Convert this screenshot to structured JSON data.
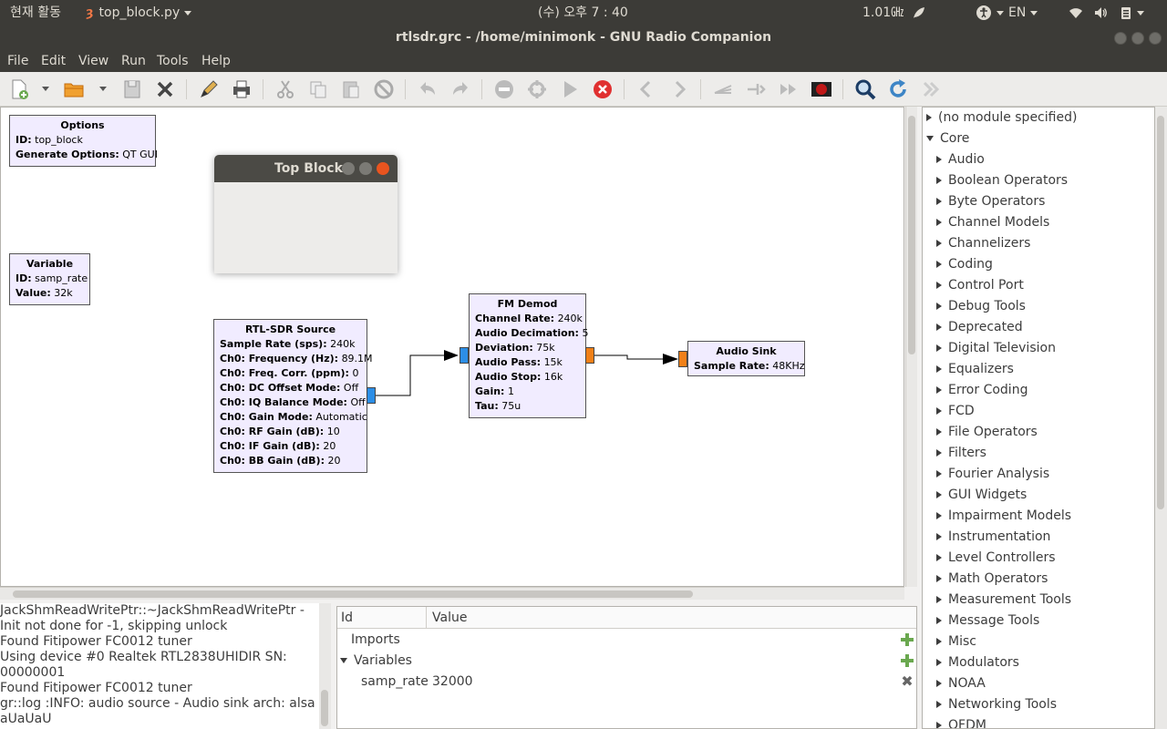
{
  "top_panel": {
    "activities": "현재 활동",
    "app_name": "top_block.py",
    "clock": "(수) 오후  7 : 40",
    "cpu_freq": "1.01㎓",
    "language": "EN"
  },
  "window": {
    "title": "rtlsdr.grc - /home/minimonk - GNU Radio Companion"
  },
  "menu": [
    "File",
    "Edit",
    "View",
    "Run",
    "Tools",
    "Help"
  ],
  "toolbar": {
    "icons": [
      "new-icon",
      "open-icon",
      "save-icon",
      "close-icon",
      "properties-icon",
      "print-icon",
      "cut-icon",
      "copy-icon",
      "paste-icon",
      "delete-icon",
      "undo-icon",
      "redo-icon",
      "disable-icon",
      "bypass-icon",
      "execute-icon",
      "kill-icon",
      "rotate-left-icon",
      "rotate-right-icon",
      "create-hier-icon",
      "open-hier-icon",
      "forward-icon",
      "screenshot-icon",
      "find-icon",
      "reload-icon",
      "reload-blocks-icon"
    ]
  },
  "blocks": {
    "options": {
      "title": "Options",
      "params": [
        [
          "ID:",
          "top_block"
        ],
        [
          "Generate Options:",
          "QT GUI"
        ]
      ]
    },
    "variable": {
      "title": "Variable",
      "params": [
        [
          "ID:",
          "samp_rate"
        ],
        [
          "Value:",
          "32k"
        ]
      ]
    },
    "rtlsdr": {
      "title": "RTL-SDR Source",
      "params": [
        [
          "Sample Rate (sps):",
          "240k"
        ],
        [
          "Ch0: Frequency (Hz):",
          "89.1M"
        ],
        [
          "Ch0: Freq. Corr. (ppm):",
          "0"
        ],
        [
          "Ch0: DC Offset Mode:",
          "Off"
        ],
        [
          "Ch0: IQ Balance Mode:",
          "Off"
        ],
        [
          "Ch0: Gain Mode:",
          "Automatic"
        ],
        [
          "Ch0: RF Gain (dB):",
          "10"
        ],
        [
          "Ch0: IF Gain (dB):",
          "20"
        ],
        [
          "Ch0: BB Gain (dB):",
          "20"
        ]
      ]
    },
    "fm_demod": {
      "title": "FM Demod",
      "params": [
        [
          "Channel Rate:",
          "240k"
        ],
        [
          "Audio Decimation:",
          "5"
        ],
        [
          "Deviation:",
          "75k"
        ],
        [
          "Audio Pass:",
          "15k"
        ],
        [
          "Audio Stop:",
          "16k"
        ],
        [
          "Gain:",
          "1"
        ],
        [
          "Tau:",
          "75u"
        ]
      ]
    },
    "audio_sink": {
      "title": "Audio Sink",
      "params": [
        [
          "Sample Rate:",
          "48KHz"
        ]
      ]
    }
  },
  "top_block_window": {
    "title": "Top Block"
  },
  "block_tree": {
    "items": [
      {
        "label": "(no module specified)",
        "expanded": false,
        "level": 0
      },
      {
        "label": "Core",
        "expanded": true,
        "level": 0
      },
      {
        "label": "Audio",
        "expanded": false,
        "level": 1
      },
      {
        "label": "Boolean Operators",
        "expanded": false,
        "level": 1
      },
      {
        "label": "Byte Operators",
        "expanded": false,
        "level": 1
      },
      {
        "label": "Channel Models",
        "expanded": false,
        "level": 1
      },
      {
        "label": "Channelizers",
        "expanded": false,
        "level": 1
      },
      {
        "label": "Coding",
        "expanded": false,
        "level": 1
      },
      {
        "label": "Control Port",
        "expanded": false,
        "level": 1
      },
      {
        "label": "Debug Tools",
        "expanded": false,
        "level": 1
      },
      {
        "label": "Deprecated",
        "expanded": false,
        "level": 1
      },
      {
        "label": "Digital Television",
        "expanded": false,
        "level": 1
      },
      {
        "label": "Equalizers",
        "expanded": false,
        "level": 1
      },
      {
        "label": "Error Coding",
        "expanded": false,
        "level": 1
      },
      {
        "label": "FCD",
        "expanded": false,
        "level": 1
      },
      {
        "label": "File Operators",
        "expanded": false,
        "level": 1
      },
      {
        "label": "Filters",
        "expanded": false,
        "level": 1
      },
      {
        "label": "Fourier Analysis",
        "expanded": false,
        "level": 1
      },
      {
        "label": "GUI Widgets",
        "expanded": false,
        "level": 1
      },
      {
        "label": "Impairment Models",
        "expanded": false,
        "level": 1
      },
      {
        "label": "Instrumentation",
        "expanded": false,
        "level": 1
      },
      {
        "label": "Level Controllers",
        "expanded": false,
        "level": 1
      },
      {
        "label": "Math Operators",
        "expanded": false,
        "level": 1
      },
      {
        "label": "Measurement Tools",
        "expanded": false,
        "level": 1
      },
      {
        "label": "Message Tools",
        "expanded": false,
        "level": 1
      },
      {
        "label": "Misc",
        "expanded": false,
        "level": 1
      },
      {
        "label": "Modulators",
        "expanded": false,
        "level": 1
      },
      {
        "label": "NOAA",
        "expanded": false,
        "level": 1
      },
      {
        "label": "Networking Tools",
        "expanded": false,
        "level": 1
      },
      {
        "label": "OFDM",
        "expanded": false,
        "level": 1
      }
    ]
  },
  "console": {
    "lines": [
      "JackShmReadWritePtr::~JackShmReadWritePtr -",
      "Init not done for -1, skipping unlock",
      "Found Fitipower FC0012 tuner",
      "Using device #0 Realtek RTL2838UHIDIR SN:",
      "00000001",
      "Found Fitipower FC0012 tuner",
      "gr::log :INFO: audio source - Audio sink arch: alsa",
      "aUaUaU"
    ]
  },
  "variables_panel": {
    "col_id": "Id",
    "col_value": "Value",
    "imports_label": "Imports",
    "variables_label": "Variables",
    "var_name": "samp_rate",
    "var_value": "32000"
  },
  "colors": {
    "block_bg": "#f1ecff",
    "port_complex": "#2c8ee6",
    "port_float": "#f08018",
    "panel_dark": "#3c3b37"
  }
}
